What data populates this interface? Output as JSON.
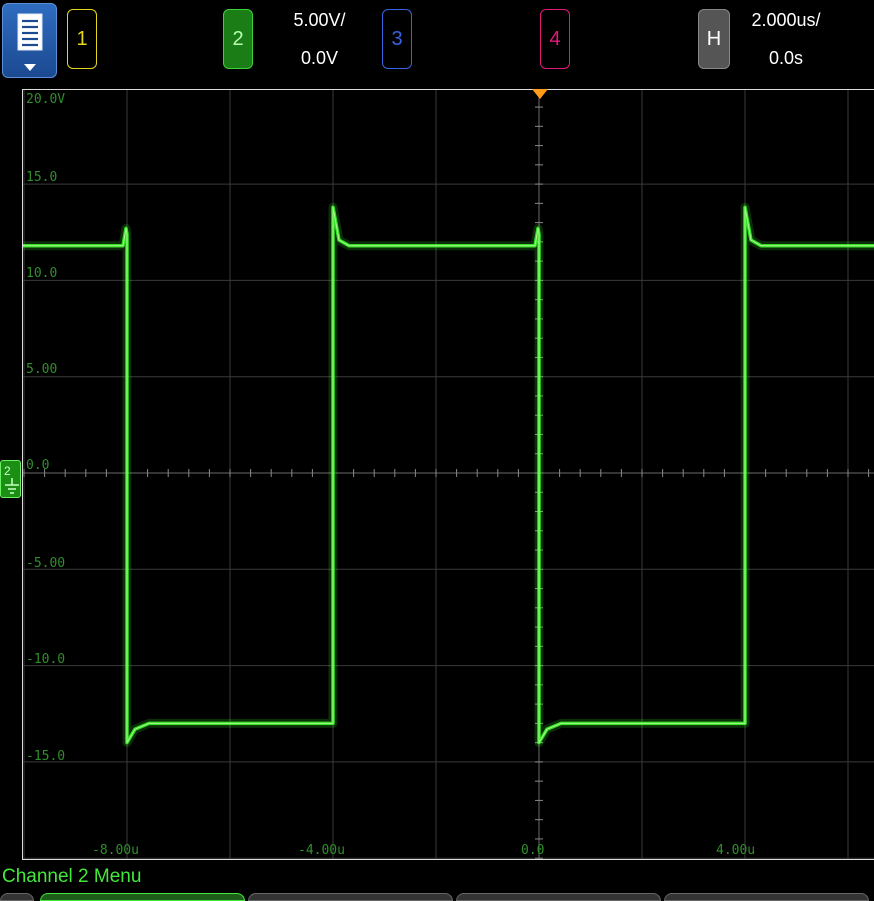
{
  "header": {
    "menu_icon": "document-list-icon",
    "channels": [
      {
        "label": "1",
        "color": "#e5d619"
      },
      {
        "label": "2",
        "color": "#3fd13a"
      },
      {
        "label": "3",
        "color": "#3762e0"
      },
      {
        "label": "4",
        "color": "#e0197a"
      }
    ],
    "ch2_scale": "5.00V/",
    "ch2_offset": "0.0V",
    "horizontal_label": "H",
    "time_scale": "2.000us/",
    "time_delay": "0.0s"
  },
  "display": {
    "y_labels": [
      "20.0V",
      "15.0",
      "10.0",
      "5.00",
      "0.0",
      "-5.00",
      "-10.0",
      "-15.0"
    ],
    "x_labels": [
      "-8.00u",
      "-4.00u",
      "0.0",
      "4.00u"
    ],
    "trace_color": "#3cff2a",
    "grid_color": "#3a3a3a",
    "trigger_color": "#ff9d1a"
  },
  "waveform": {
    "volts_per_div": 5.0,
    "time_per_div_us": 2.0,
    "high_level_v": 11.8,
    "low_level_v": -13.0,
    "period_us": 8.0,
    "duty": 0.5,
    "x_range_us": [
      -10.0,
      10.0
    ]
  },
  "footer": {
    "menu_title": "Channel 2 Menu"
  }
}
